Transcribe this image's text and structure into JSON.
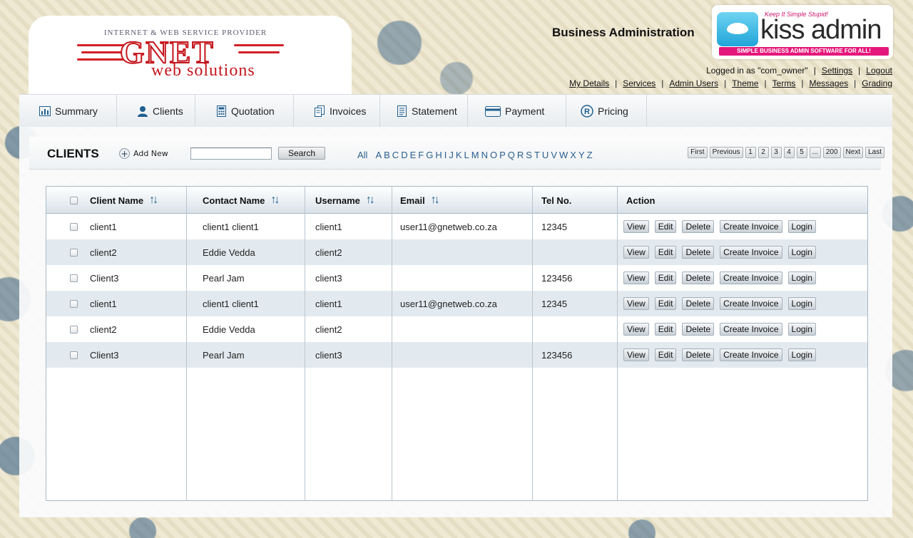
{
  "header": {
    "logo": {
      "tagline": "INTERNET & WEB SERVICE PROVIDER",
      "name": "GNET",
      "sub": "web solutions"
    },
    "business_title": "Business Administration",
    "kiss": {
      "tagline": "Keep It Simple Stupid!",
      "name": "kiss admin",
      "strip": "SIMPLE BUSINESS ADMIN SOFTWARE FOR ALL!"
    },
    "logged_in_text": "Logged in as \"com_owner\"",
    "settings_label": "Settings",
    "logout_label": "Logout",
    "links": [
      "My Details",
      "Services",
      "Admin Users",
      "Theme",
      "Terms",
      "Messages",
      "Grading"
    ]
  },
  "nav": [
    {
      "label": "Summary",
      "icon": "chart-icon"
    },
    {
      "label": "Clients",
      "icon": "user-icon"
    },
    {
      "label": "Quotation",
      "icon": "calculator-icon"
    },
    {
      "label": "Invoices",
      "icon": "documents-icon"
    },
    {
      "label": "Statement",
      "icon": "statement-icon"
    },
    {
      "label": "Payment",
      "icon": "card-icon"
    },
    {
      "label": "Pricing",
      "icon": "registered-icon"
    }
  ],
  "toolbar": {
    "title": "CLIENTS",
    "add_new": "Add New",
    "search_value": "",
    "search_label": "Search",
    "alphabet": [
      "All",
      "A",
      "B",
      "C",
      "D",
      "E",
      "F",
      "G",
      "H",
      "I",
      "J",
      "K",
      "L",
      "M",
      "N",
      "O",
      "P",
      "Q",
      "R",
      "S",
      "T",
      "U",
      "V",
      "W",
      "X",
      "Y",
      "Z"
    ],
    "pager": [
      "First",
      "Previous",
      "1",
      "2",
      "3",
      "4",
      "5",
      "...",
      "200",
      "Next",
      "Last"
    ]
  },
  "table": {
    "columns": [
      "Client Name",
      "Contact Name",
      "Username",
      "Email",
      "Tel No.",
      "Action"
    ],
    "actions": [
      "View",
      "Edit",
      "Delete",
      "Create Invoice",
      "Login"
    ],
    "rows": [
      {
        "client": "client1",
        "contact": "client1 client1",
        "username": "client1",
        "email": "user11@gnetweb.co.za",
        "tel": "12345"
      },
      {
        "client": "client2",
        "contact": "Eddie Vedda",
        "username": "client2",
        "email": "",
        "tel": ""
      },
      {
        "client": "Client3",
        "contact": "Pearl Jam",
        "username": "client3",
        "email": "",
        "tel": "123456"
      },
      {
        "client": "client1",
        "contact": "client1 client1",
        "username": "client1",
        "email": "user11@gnetweb.co.za",
        "tel": "12345"
      },
      {
        "client": "client2",
        "contact": "Eddie Vedda",
        "username": "client2",
        "email": "",
        "tel": ""
      },
      {
        "client": "Client3",
        "contact": "Pearl Jam",
        "username": "client3",
        "email": "",
        "tel": "123456"
      }
    ]
  }
}
